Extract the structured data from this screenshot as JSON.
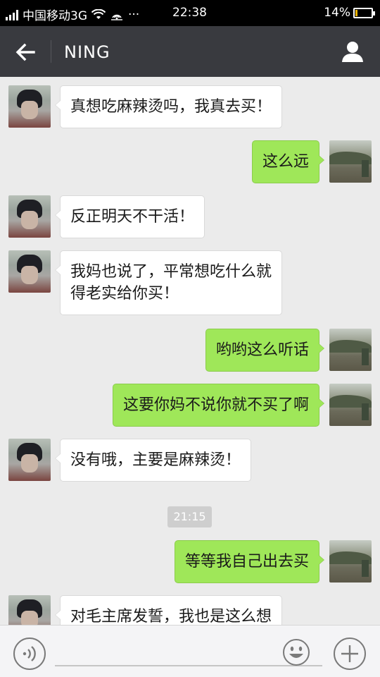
{
  "status_bar": {
    "carrier": "中国移动3G",
    "more": "···",
    "time": "22:38",
    "battery_percent": "14%",
    "battery_level": 0.14
  },
  "nav": {
    "title": "NING"
  },
  "messages": [
    {
      "from": "contact",
      "text": "真想吃麻辣烫吗，我真去买！"
    },
    {
      "from": "me",
      "text": "这么远"
    },
    {
      "from": "contact",
      "text": "反正明天不干活！"
    },
    {
      "from": "contact",
      "lines": [
        "我妈也说了，平常想吃什么就",
        "得老实给你买！"
      ]
    },
    {
      "from": "me",
      "text": "哟哟这么听话"
    },
    {
      "from": "me",
      "text": "这要你妈不说你就不买了啊"
    },
    {
      "from": "contact",
      "text": "没有哦，主要是麻辣烫！"
    },
    {
      "from": "me",
      "text": "等等我自己出去买"
    },
    {
      "from": "contact",
      "text": "对毛主席发誓，我也是这么想"
    }
  ],
  "timestamp": "21:15",
  "colors": {
    "nav_bg": "#393a3f",
    "chat_bg": "#ebebeb",
    "sent_bubble": "#9fe759",
    "received_bubble": "#ffffff"
  },
  "icons": {
    "back": "arrow-left-icon",
    "profile": "person-icon",
    "voice": "voice-icon",
    "emoji": "smiley-icon",
    "more": "plus-icon"
  }
}
